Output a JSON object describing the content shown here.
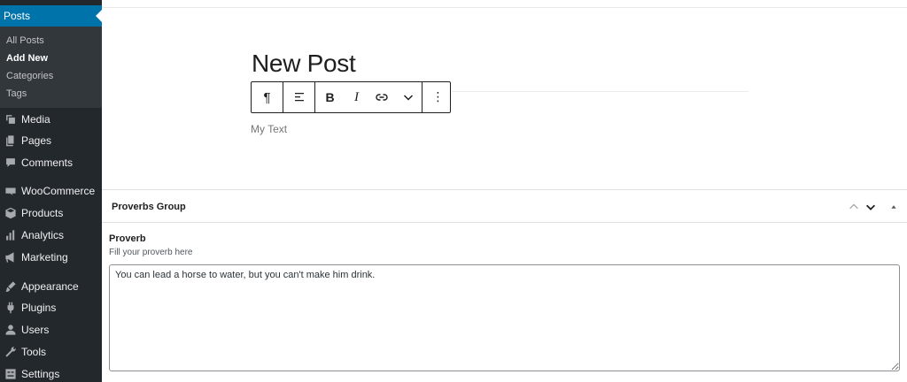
{
  "sidebar": {
    "active": {
      "label": "Posts",
      "icon": "pin-icon"
    },
    "submenu": [
      {
        "label": "All Posts"
      },
      {
        "label": "Add New"
      },
      {
        "label": "Categories"
      },
      {
        "label": "Tags"
      }
    ],
    "items": [
      {
        "label": "Media",
        "icon": "media-icon"
      },
      {
        "label": "Pages",
        "icon": "pages-icon"
      },
      {
        "label": "Comments",
        "icon": "comments-icon"
      },
      {
        "label": "WooCommerce",
        "icon": "woocommerce-icon"
      },
      {
        "label": "Products",
        "icon": "products-icon"
      },
      {
        "label": "Analytics",
        "icon": "analytics-icon"
      },
      {
        "label": "Marketing",
        "icon": "marketing-icon"
      },
      {
        "label": "Appearance",
        "icon": "appearance-icon"
      },
      {
        "label": "Plugins",
        "icon": "plugins-icon"
      },
      {
        "label": "Users",
        "icon": "users-icon"
      },
      {
        "label": "Tools",
        "icon": "tools-icon"
      },
      {
        "label": "Settings",
        "icon": "settings-icon"
      }
    ]
  },
  "editor": {
    "title": "New Post",
    "paragraph": "My Text",
    "toolbar": {
      "paragraph_glyph": "¶",
      "bold_glyph": "B",
      "italic_glyph": "I",
      "more_glyph": "⋮"
    }
  },
  "metabox": {
    "title": "Proverbs Group",
    "field_label": "Proverb",
    "field_description": "Fill your proverb here",
    "field_value": "You can lead a horse to water, but you can't make him drink."
  },
  "colors": {
    "sidebar_bg": "#23282d",
    "submenu_bg": "#32373c",
    "accent": "#0073aa"
  }
}
